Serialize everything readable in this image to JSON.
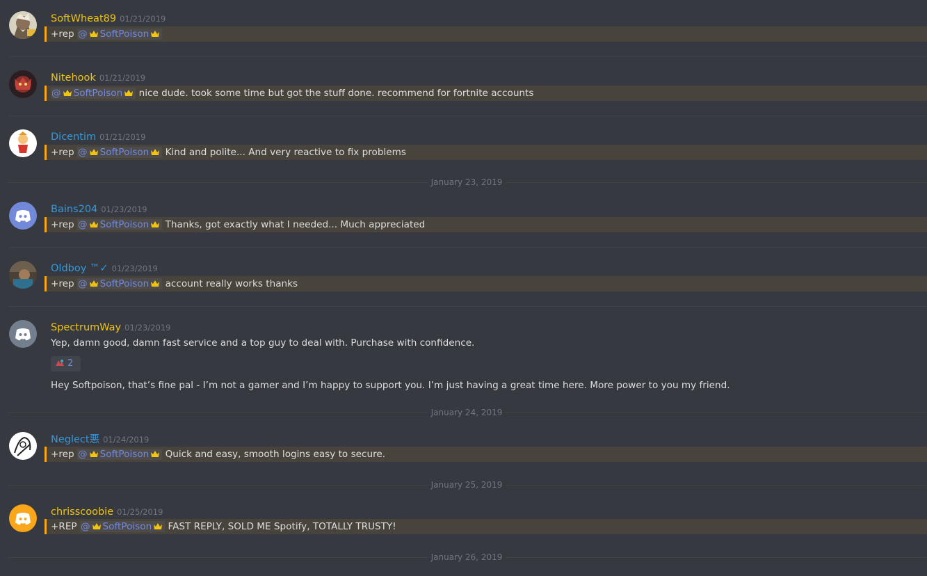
{
  "colors": {
    "background": "#36393f",
    "yellow_name": "#f1c40f",
    "blue_name": "#3498db",
    "mention": "#7289da",
    "highlight_border": "#faa61a",
    "timestamp": "#72767d"
  },
  "messages": [
    {
      "username": "SoftWheat89",
      "timestamp": "01/21/2019",
      "prefix": "+rep",
      "mention_user": "SoftPoison",
      "text": "",
      "avatar_icon": "anime-avatar-icon",
      "name_color": "#f1c40f"
    },
    {
      "username": "Nitehook",
      "timestamp": "01/21/2019",
      "prefix": "",
      "mention_user": "SoftPoison",
      "text": "nice dude. took some time but got the stuff done. recommend for fortnite accounts",
      "avatar_icon": "character-avatar-icon",
      "name_color": "#f1c40f"
    },
    {
      "username": "Dicentim",
      "timestamp": "01/21/2019",
      "prefix": "+rep",
      "mention_user": "SoftPoison",
      "text": "Kind and polite... And very reactive to fix problems",
      "avatar_icon": "cartoon-avatar-icon",
      "name_color": "#3498db"
    },
    {
      "username": "Bains204",
      "timestamp": "01/23/2019",
      "prefix": "+rep",
      "mention_user": "SoftPoison",
      "text": "Thanks, got exactly what I needed... Much appreciated",
      "avatar_icon": "discord-default-avatar-icon",
      "name_color": "#3498db"
    },
    {
      "username": "Oldboy ™✓",
      "timestamp": "01/23/2019",
      "prefix": "+rep",
      "mention_user": "SoftPoison",
      "text": "account really works thanks",
      "avatar_icon": "photo-avatar-icon",
      "name_color": "#3498db"
    },
    {
      "username": "SpectrumWay",
      "timestamp": "01/23/2019",
      "text_line1": "Yep, damn good, damn fast service and a top guy to deal with. Purchase with confidence.",
      "reaction_count": "2",
      "text_line2": "Hey Softpoison, that’s fine pal - I’m not a gamer and I’m happy to support you. I’m just having a great time here. More power to you my friend.",
      "avatar_icon": "discord-default-avatar-icon",
      "name_color": "#f1c40f"
    },
    {
      "username": "Neglect悪",
      "timestamp": "01/24/2019",
      "prefix": "+rep",
      "mention_user": "SoftPoison",
      "text": "Quick and easy, smooth logins easy to secure.",
      "avatar_icon": "sketch-avatar-icon",
      "name_color": "#3498db"
    },
    {
      "username": "chrisscoobie",
      "timestamp": "01/25/2019",
      "prefix": "+REP",
      "mention_user": "SoftPoison",
      "text": "FAST REPLY, SOLD ME Spotify, TOTALLY TRUSTY!",
      "avatar_icon": "discord-default-avatar-icon",
      "name_color": "#f1c40f"
    }
  ],
  "date_dividers": [
    "January 23, 2019",
    "January 24, 2019",
    "January 25, 2019",
    "January 26, 2019"
  ],
  "mention_prefix": "@"
}
